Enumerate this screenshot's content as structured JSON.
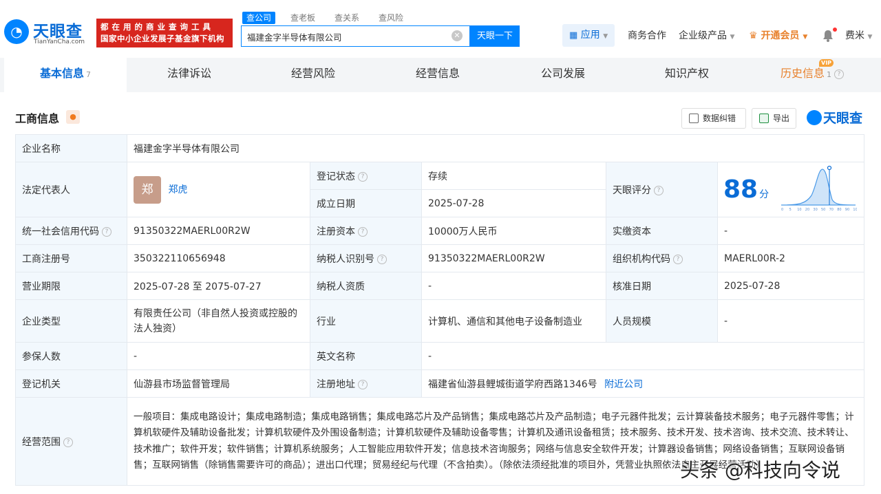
{
  "header": {
    "logo_text": "天眼查",
    "logo_sub": "TianYanCha.com",
    "slogan_line1": "都 在 用 的 商 业 查 询 工 具",
    "slogan_line2": "国家中小企业发展子基金旗下机构",
    "search_tabs": [
      "查公司",
      "查老板",
      "查关系",
      "查风险"
    ],
    "search_value": "福建金字半导体有限公司",
    "search_button": "天眼一下",
    "app_label": "应用",
    "nav": [
      "商务合作",
      "企业级产品",
      "开通会员",
      "费米"
    ]
  },
  "tabs": [
    {
      "label": "基本信息",
      "count": "7"
    },
    {
      "label": "法律诉讼"
    },
    {
      "label": "经营风险"
    },
    {
      "label": "经营信息"
    },
    {
      "label": "公司发展"
    },
    {
      "label": "知识产权"
    },
    {
      "label": "历史信息",
      "count": "1",
      "badge": "VIP"
    }
  ],
  "section": {
    "title": "工商信息",
    "correct_button": "数据纠错",
    "export_button": "导出",
    "brand": "天眼查"
  },
  "info": {
    "company_name_label": "企业名称",
    "company_name": "福建金字半导体有限公司",
    "legal_rep_label": "法定代表人",
    "legal_rep_avatar": "郑",
    "legal_rep": "郑虎",
    "reg_status_label": "登记状态",
    "reg_status": "存续",
    "est_date_label": "成立日期",
    "est_date": "2025-07-28",
    "score_label": "天眼评分",
    "score": "88",
    "score_unit": "分",
    "score_ticks": [
      "0",
      "5",
      "10",
      "20",
      "30",
      "50",
      "70",
      "80",
      "90",
      "100"
    ],
    "credit_code_label": "统一社会信用代码",
    "credit_code": "91350322MAERL00R2W",
    "reg_capital_label": "注册资本",
    "reg_capital": "10000万人民币",
    "paid_capital_label": "实缴资本",
    "paid_capital": "-",
    "reg_no_label": "工商注册号",
    "reg_no": "350322110656948",
    "taxpayer_id_label": "纳税人识别号",
    "taxpayer_id": "91350322MAERL00R2W",
    "org_code_label": "组织机构代码",
    "org_code": "MAERL00R-2",
    "term_label": "营业期限",
    "term": "2025-07-28 至 2075-07-27",
    "tax_qual_label": "纳税人资质",
    "tax_qual": "-",
    "approve_date_label": "核准日期",
    "approve_date": "2025-07-28",
    "type_label": "企业类型",
    "type": "有限责任公司（非自然人投资或控股的法人独资）",
    "industry_label": "行业",
    "industry": "计算机、通信和其他电子设备制造业",
    "staff_label": "人员规模",
    "staff": "-",
    "insured_label": "参保人数",
    "insured": "-",
    "english_label": "英文名称",
    "english": "-",
    "authority_label": "登记机关",
    "authority": "仙游县市场监督管理局",
    "address_label": "注册地址",
    "address": "福建省仙游县鲤城街道学府西路1346号",
    "nearby": "附近公司",
    "scope_label": "经营范围",
    "scope": "一般项目：集成电路设计；集成电路制造；集成电路销售；集成电路芯片及产品销售；集成电路芯片及产品制造；电子元器件批发；云计算装备技术服务；电子元器件零售；计算机软硬件及辅助设备批发；计算机软硬件及外围设备制造；计算机软硬件及辅助设备零售；计算机及通讯设备租赁；技术服务、技术开发、技术咨询、技术交流、技术转让、技术推广；软件开发；软件销售；计算机系统服务；人工智能应用软件开发；信息技术咨询服务；网络与信息安全软件开发；计算器设备销售；网络设备销售；互联网设备销售；互联网销售（除销售需要许可的商品）；进出口代理；贸易经纪与代理（不含拍卖）。（除依法须经批准的项目外，凭营业执照依法自主开展经营活动）"
  },
  "watermark": "头条 @科技向令说",
  "colors": {
    "brand_blue": "#0084ff",
    "link_blue": "#0a6cd6",
    "slogan_red": "#d7261e",
    "status_green": "#1a9a3b",
    "vip_orange": "#f7a238"
  }
}
